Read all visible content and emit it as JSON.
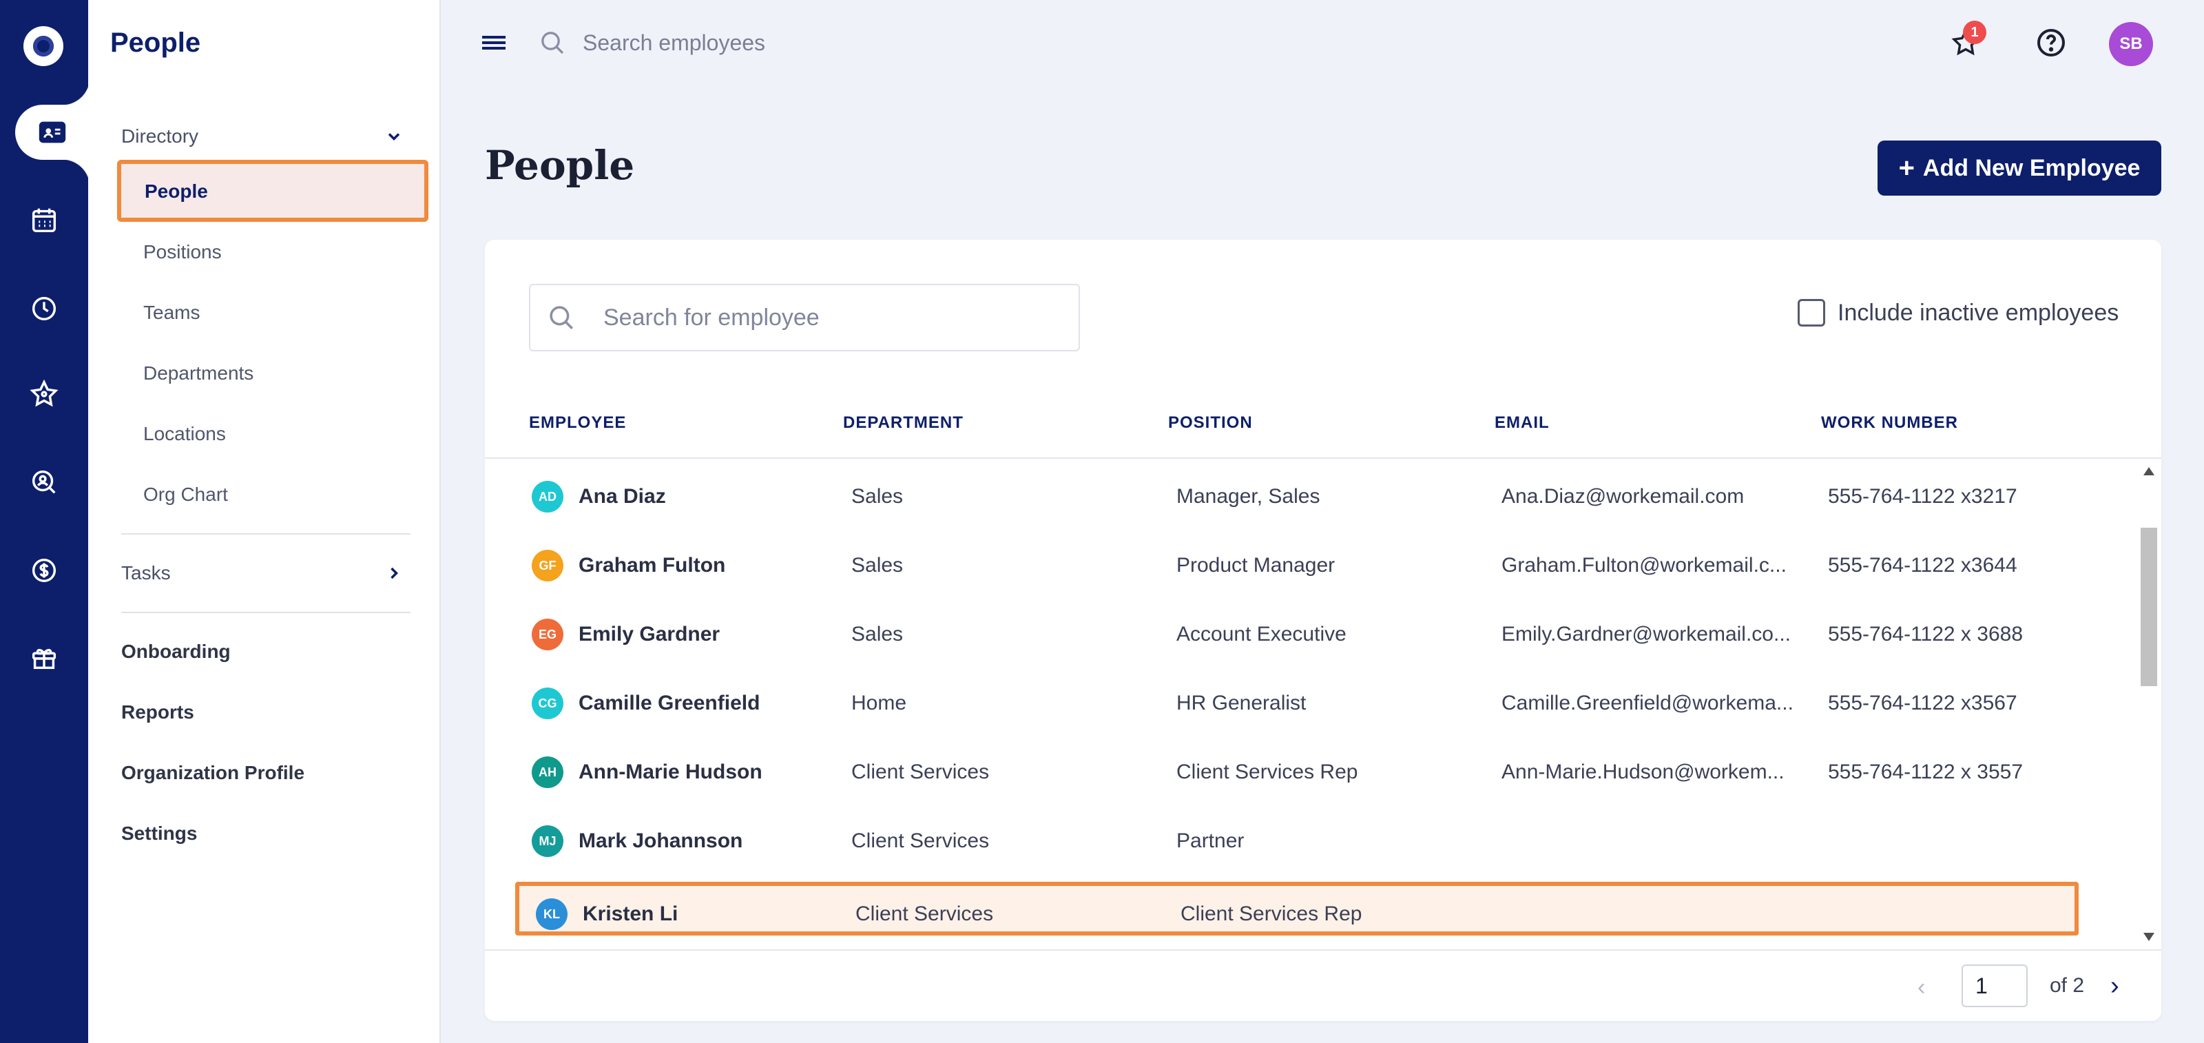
{
  "sidebar": {
    "title": "People",
    "directory_label": "Directory",
    "directory_items": [
      {
        "label": "People"
      },
      {
        "label": "Positions"
      },
      {
        "label": "Teams"
      },
      {
        "label": "Departments"
      },
      {
        "label": "Locations"
      },
      {
        "label": "Org Chart"
      }
    ],
    "tasks_label": "Tasks",
    "main_items": [
      {
        "label": "Onboarding"
      },
      {
        "label": "Reports"
      },
      {
        "label": "Organization Profile"
      },
      {
        "label": "Settings"
      }
    ]
  },
  "rail": {
    "icons": [
      "logo-icon",
      "directory-card-icon",
      "calendar-icon",
      "clock-icon",
      "star-icon",
      "person-search-icon",
      "dollar-icon",
      "gift-icon"
    ]
  },
  "topbar": {
    "search_placeholder": "Search employees",
    "notification_count": "1",
    "user_initials": "SB"
  },
  "page": {
    "title": "People",
    "add_button_label": "Add New Employee",
    "add_button_plus": "+"
  },
  "table": {
    "search_placeholder": "Search for employee",
    "include_inactive_label": "Include inactive employees",
    "columns": [
      "EMPLOYEE",
      "DEPARTMENT",
      "POSITION",
      "EMAIL",
      "WORK NUMBER"
    ],
    "rows": [
      {
        "initials": "AD",
        "color": "#1ec8d2",
        "name": "Ana Diaz",
        "department": "Sales",
        "position": "Manager, Sales",
        "email": "Ana.Diaz@workemail.com",
        "phone": "555-764-1122 x3217"
      },
      {
        "initials": "GF",
        "color": "#f5a21d",
        "name": "Graham Fulton",
        "department": "Sales",
        "position": "Product Manager",
        "email": "Graham.Fulton@workemail.c...",
        "phone": "555-764-1122 x3644"
      },
      {
        "initials": "EG",
        "color": "#f06b3a",
        "name": "Emily Gardner",
        "department": "Sales",
        "position": "Account Executive",
        "email": "Emily.Gardner@workemail.co...",
        "phone": "555-764-1122 x 3688"
      },
      {
        "initials": "CG",
        "color": "#1ec8d2",
        "name": "Camille Greenfield",
        "department": "Home",
        "position": "HR Generalist",
        "email": "Camille.Greenfield@workema...",
        "phone": "555-764-1122 x3567"
      },
      {
        "initials": "AH",
        "color": "#0f9a8c",
        "name": "Ann-Marie Hudson",
        "department": "Client Services",
        "position": "Client Services Rep",
        "email": "Ann-Marie.Hudson@workem...",
        "phone": "555-764-1122 x 3557"
      },
      {
        "initials": "MJ",
        "color": "#139c9a",
        "name": "Mark Johannson",
        "department": "Client Services",
        "position": "Partner",
        "email": "",
        "phone": ""
      },
      {
        "initials": "KL",
        "color": "#2a8fd8",
        "name": "Kristen Li",
        "department": "Client Services",
        "position": "Client Services Rep",
        "email": "",
        "phone": ""
      }
    ]
  },
  "pagination": {
    "current_page": "1",
    "of_label": "of 2",
    "prev": "‹",
    "next": "›"
  }
}
